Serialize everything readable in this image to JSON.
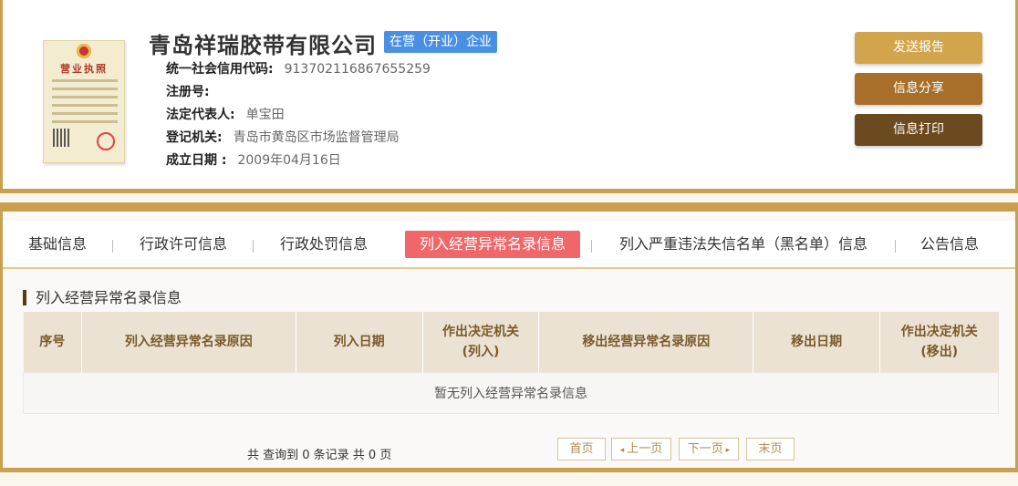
{
  "company": {
    "name": "青岛祥瑞胶带有限公司",
    "status_badge": "在营（开业）企业",
    "license_caption": "营业执照",
    "fields": [
      {
        "label": "统一社会信用代码:",
        "value": "913702116867655259"
      },
      {
        "label": "注册号:",
        "value": ""
      },
      {
        "label": "法定代表人:",
        "value": "单宝田"
      },
      {
        "label": "登记机关:",
        "value": "青岛市黄岛区市场监督管理局"
      },
      {
        "label": "成立日期 :",
        "value": "2009年04月16日"
      }
    ]
  },
  "actions": {
    "report": "发送报告",
    "share": "信息分享",
    "print": "信息打印"
  },
  "tabs": [
    {
      "label": "基础信息",
      "active": false
    },
    {
      "label": "行政许可信息",
      "active": false
    },
    {
      "label": "行政处罚信息",
      "active": false
    },
    {
      "label": "列入经营异常名录信息",
      "active": true
    },
    {
      "label": "列入严重违法失信名单（黑名单）信息",
      "active": false
    },
    {
      "label": "公告信息",
      "active": false
    }
  ],
  "section": {
    "title": "列入经营异常名录信息",
    "columns": [
      "序号",
      "列入经营异常名录原因",
      "列入日期",
      "作出决定机关(列入)",
      "移出经营异常名录原因",
      "移出日期",
      "作出决定机关(移出)"
    ],
    "empty_message": "暂无列入经营异常名录信息"
  },
  "pagination": {
    "summary": "共 查询到 0 条记录 共 0 页",
    "first": "首页",
    "prev": "上一页",
    "next": "下一页",
    "last": "末页"
  },
  "colors": {
    "accent_gold": "#c9a04e",
    "active_tab": "#f0676a",
    "status_badge": "#4a90e2"
  }
}
